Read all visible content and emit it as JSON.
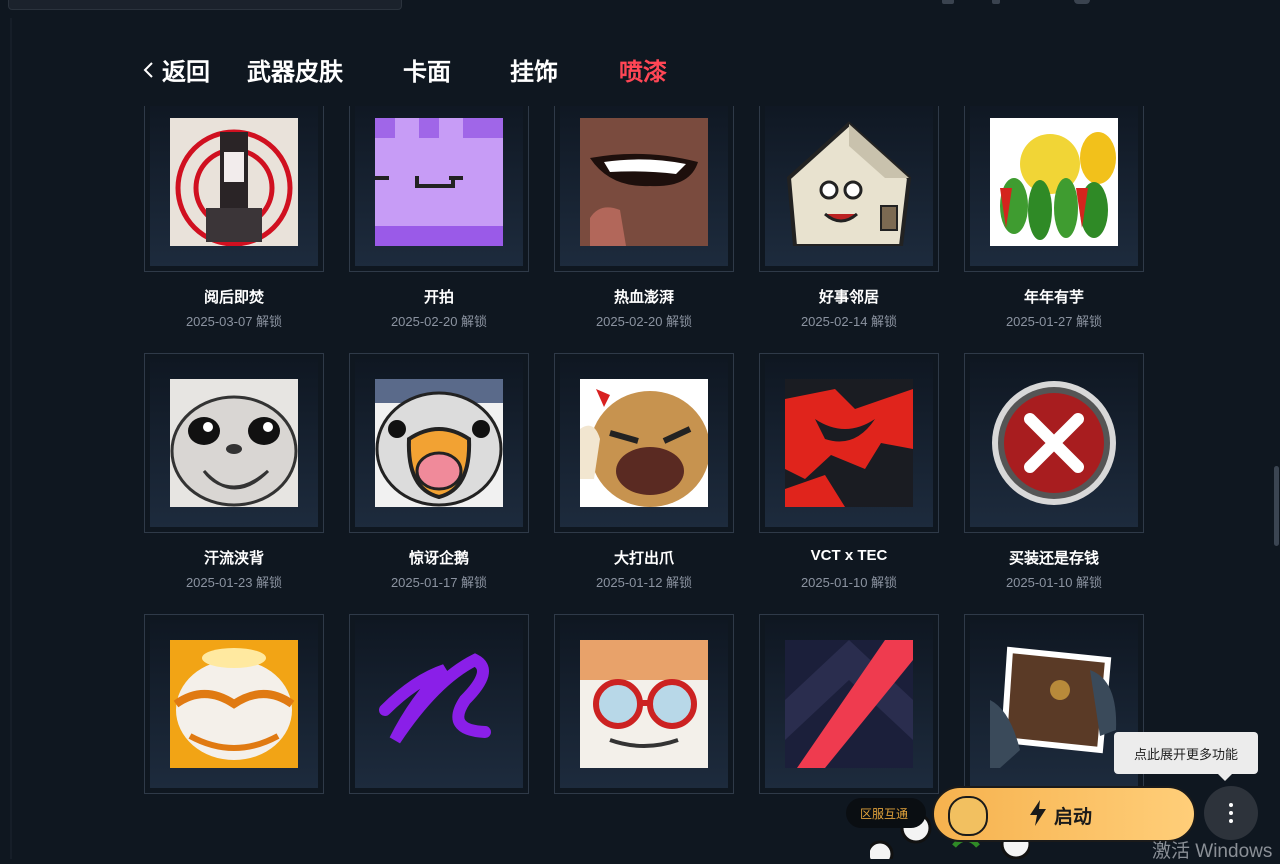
{
  "nav": {
    "back_label": "返回",
    "tabs": [
      {
        "label": "武器皮肤",
        "active": false
      },
      {
        "label": "卡面",
        "active": false
      },
      {
        "label": "挂饰",
        "active": false
      },
      {
        "label": "喷漆",
        "active": true
      }
    ]
  },
  "sprays": [
    {
      "name": "阅后即焚",
      "date": "2025-03-07 解锁",
      "icon": "burn-after-reading-spray"
    },
    {
      "name": "开拍",
      "date": "2025-02-20 解锁",
      "icon": "purple-face-spray"
    },
    {
      "name": "热血澎湃",
      "date": "2025-02-20 解锁",
      "icon": "grin-thumbs-up-spray"
    },
    {
      "name": "好事邻居",
      "date": "2025-02-14 解锁",
      "icon": "house-neighbor-spray"
    },
    {
      "name": "年年有芋",
      "date": "2025-01-27 解锁",
      "icon": "fruit-basket-spray"
    },
    {
      "name": "汗流浃背",
      "date": "2025-01-23 解锁",
      "icon": "sweating-seal-spray"
    },
    {
      "name": "惊讶企鹅",
      "date": "2025-01-17 解锁",
      "icon": "surprised-penguin-spray"
    },
    {
      "name": "大打出爪",
      "date": "2025-01-12 解锁",
      "icon": "angry-tiger-spray"
    },
    {
      "name": "VCT x TEC",
      "date": "2025-01-10 解锁",
      "icon": "vct-tec-spray"
    },
    {
      "name": "买装还是存钱",
      "date": "2025-01-10 解锁",
      "icon": "red-x-button-spray"
    },
    {
      "name": "",
      "date": "",
      "icon": "golden-mask-spray"
    },
    {
      "name": "",
      "date": "",
      "icon": "purple-signature-spray"
    },
    {
      "name": "",
      "date": "",
      "icon": "goggles-character-spray"
    },
    {
      "name": "",
      "date": "",
      "icon": "chevron-logo-spray"
    },
    {
      "name": "",
      "date": "",
      "icon": "empty-wallet-spray"
    }
  ],
  "footer": {
    "tooltip": "点此展开更多功能",
    "region_label": "区服互通",
    "launch_label": "启动",
    "watermark": "激活 Windows"
  },
  "colors": {
    "background": "#0f1720",
    "active_tab": "#ff4655",
    "launch_button": "#ffc25e"
  }
}
